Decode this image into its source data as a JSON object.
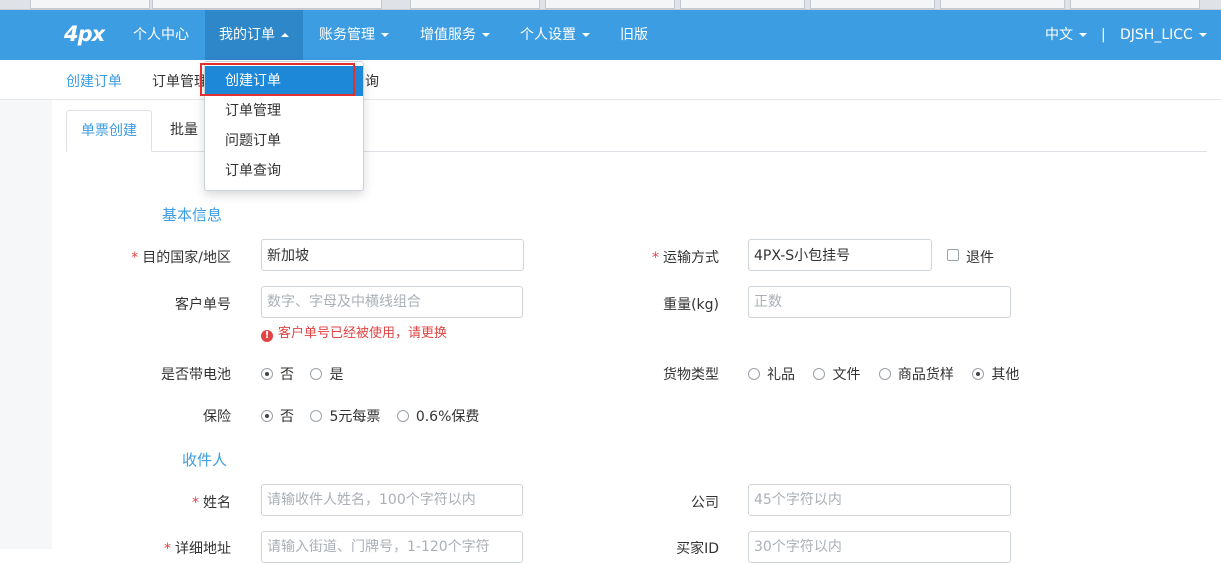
{
  "navbar": {
    "brand": "4px",
    "items": [
      {
        "label": "个人中心"
      },
      {
        "label": "我的订单"
      },
      {
        "label": "账务管理"
      },
      {
        "label": "增值服务"
      },
      {
        "label": "个人设置"
      },
      {
        "label": "旧版"
      }
    ],
    "language": "中文",
    "separator": "|",
    "user": "DJSH_LICC"
  },
  "subnav": {
    "items": [
      {
        "label": "创建订单"
      },
      {
        "label": "订单管理"
      },
      {
        "label": "询"
      }
    ]
  },
  "dropdown": {
    "items": [
      {
        "label": "创建订单"
      },
      {
        "label": "订单管理"
      },
      {
        "label": "问题订单"
      },
      {
        "label": "订单查询"
      }
    ]
  },
  "tabs": [
    {
      "label": "单票创建"
    },
    {
      "label": "批量"
    }
  ],
  "basic_info": {
    "title": "基本信息",
    "required_mark": "*",
    "destination": {
      "label": "目的国家/地区",
      "value": "新加坡"
    },
    "shipping": {
      "label": "运输方式",
      "value": "4PX-S小包挂号",
      "checkbox_label": "退件"
    },
    "customer_no": {
      "label": "客户单号",
      "placeholder": "数字、字母及中横线组合",
      "error": "客户单号已经被使用，请更换",
      "error_icon": "!"
    },
    "weight": {
      "label": "重量(kg)",
      "placeholder": "正数"
    },
    "battery": {
      "label": "是否带电池",
      "options": [
        "否",
        "是"
      ],
      "selected": "否"
    },
    "goods_type": {
      "label": "货物类型",
      "options": [
        "礼品",
        "文件",
        "商品货样",
        "其他"
      ],
      "selected": "其他"
    },
    "insurance": {
      "label": "保险",
      "options": [
        "否",
        "5元每票",
        "0.6%保费"
      ],
      "selected": "否"
    }
  },
  "recipient": {
    "title": "收件人",
    "name": {
      "label": "姓名",
      "placeholder": "请输收件人姓名，100个字符以内"
    },
    "company": {
      "label": "公司",
      "placeholder": "45个字符以内"
    },
    "address": {
      "label": "详细地址",
      "placeholder": "请输入街道、门牌号，1-120个字符"
    },
    "buyer_id": {
      "label": "买家ID",
      "placeholder": "30个字符以内"
    }
  },
  "colors": {
    "primary": "#3d9de2",
    "active_nav": "#2e87c9",
    "error": "#e04444",
    "highlight": "#e03030"
  }
}
